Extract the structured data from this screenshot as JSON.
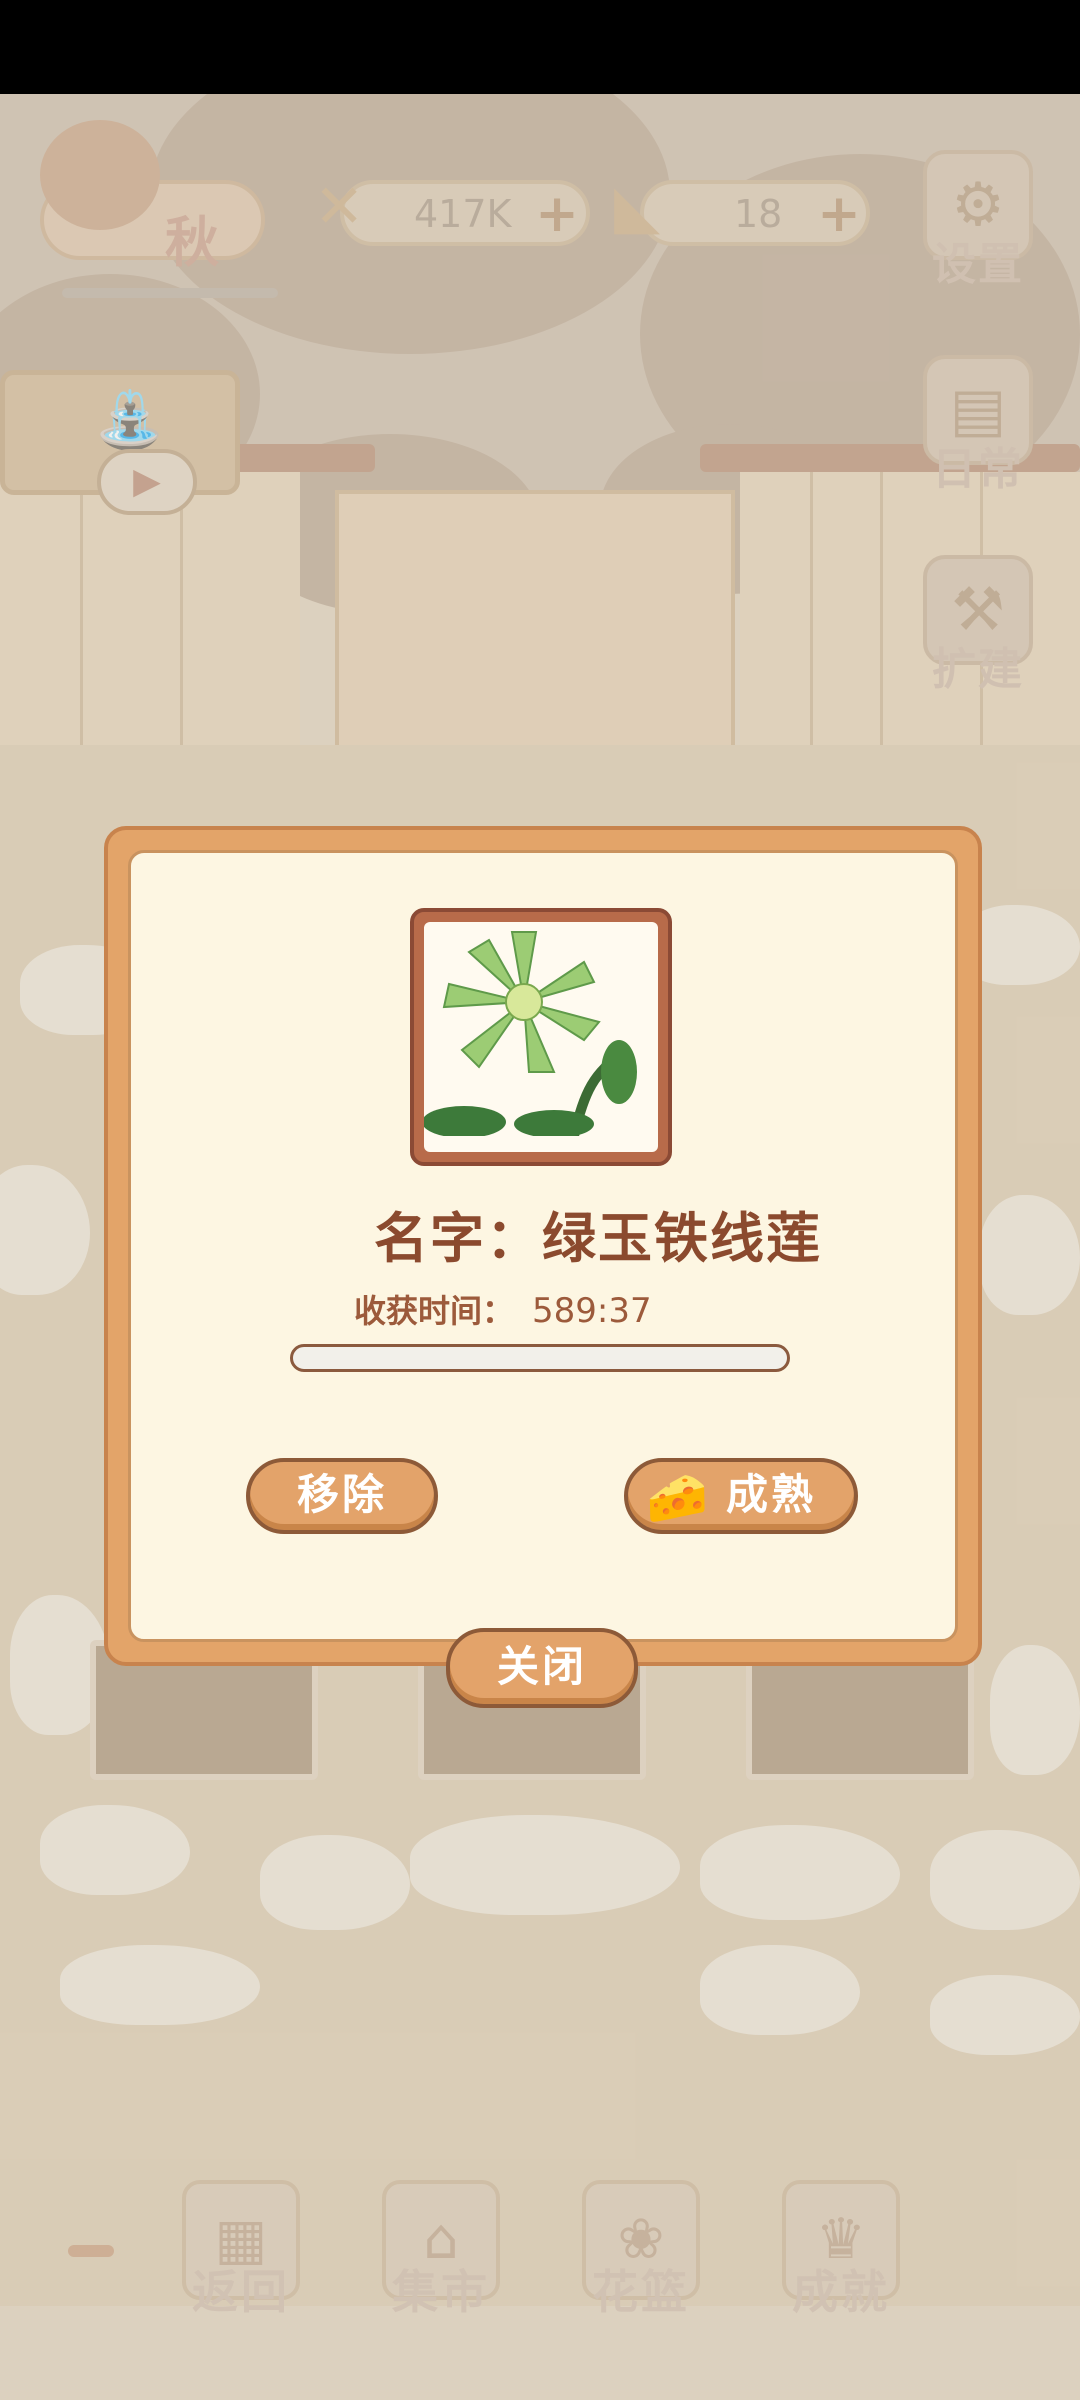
{
  "hud": {
    "season_label": "秋",
    "fish_currency": "417K",
    "cheese_currency": "18"
  },
  "side_menu": {
    "settings_label": "设置",
    "daily_label": "日常",
    "expand_label": "扩建"
  },
  "bottom_nav": {
    "items": [
      {
        "label": "返回"
      },
      {
        "label": "集市"
      },
      {
        "label": "花篮"
      },
      {
        "label": "成就"
      }
    ]
  },
  "dialog": {
    "name_label": "名字：绿玉铁线莲",
    "harvest_label": "收获时间：",
    "harvest_time": "589:37",
    "progress_fraction": 0.0,
    "remove_button": "移除",
    "mature_button": "成熟",
    "close_button": "关闭"
  },
  "colors": {
    "dialog_border": "#e3a469",
    "dialog_bg": "#fdf6e2",
    "button_fill": "#e3a36a",
    "text_brown": "#8b4a2e"
  }
}
